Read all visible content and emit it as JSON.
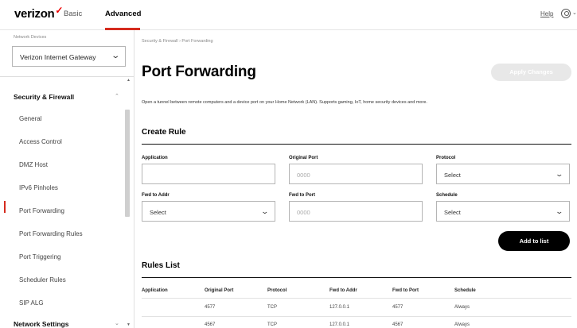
{
  "header": {
    "brand": "verizon",
    "brand_mark": "✓",
    "tabs": [
      {
        "label": "Basic",
        "active": false
      },
      {
        "label": "Advanced",
        "active": true
      }
    ],
    "help_label": "Help",
    "user_icon": "user-circle-icon",
    "accent_color": "#d52b1e"
  },
  "sidebar": {
    "device_label": "Network Devices",
    "device_select": "Verizon Internet Gateway",
    "section": "Security & Firewall",
    "items": [
      {
        "label": "General"
      },
      {
        "label": "Access Control"
      },
      {
        "label": "DMZ Host"
      },
      {
        "label": "IPv6 Pinholes"
      },
      {
        "label": "Port Forwarding",
        "active": true
      },
      {
        "label": "Port Forwarding Rules"
      },
      {
        "label": "Port Triggering"
      },
      {
        "label": "Scheduler Rules"
      },
      {
        "label": "SIP ALG"
      }
    ],
    "next_section": "Network Settings"
  },
  "main": {
    "breadcrumb": "Security & Firewall  ›  Port Forwarding",
    "title": "Port Forwarding",
    "apply_button": "Apply Changes",
    "description": "Open a tunnel between remote computers and a device port on your Home Network (LAN). Supports gaming, IoT, home security devices and more.",
    "create_rule": {
      "title": "Create Rule",
      "application_label": "Application",
      "application_value": "",
      "original_port_label": "Original Port",
      "original_port_placeholder": "0000",
      "protocol_label": "Protocol",
      "protocol_value": "Select",
      "fwd_addr_label": "Fwd to Addr",
      "fwd_addr_value": "Select",
      "fwd_port_label": "Fwd to Port",
      "fwd_port_placeholder": "0000",
      "schedule_label": "Schedule",
      "schedule_value": "Select",
      "add_button": "Add to list"
    },
    "rules_list": {
      "title": "Rules List",
      "columns": [
        "Application",
        "Original Port",
        "Protocol",
        "Fwd to Addr",
        "Fwd to Port",
        "Schedule"
      ],
      "rows": [
        {
          "application": "",
          "original_port": "4577",
          "protocol": "TCP",
          "fwd_addr": "127.0.0.1",
          "fwd_port": "4577",
          "schedule": "Always"
        },
        {
          "application": "",
          "original_port": "4567",
          "protocol": "TCP",
          "fwd_addr": "127.0.0.1",
          "fwd_port": "4567",
          "schedule": "Always"
        }
      ]
    }
  }
}
